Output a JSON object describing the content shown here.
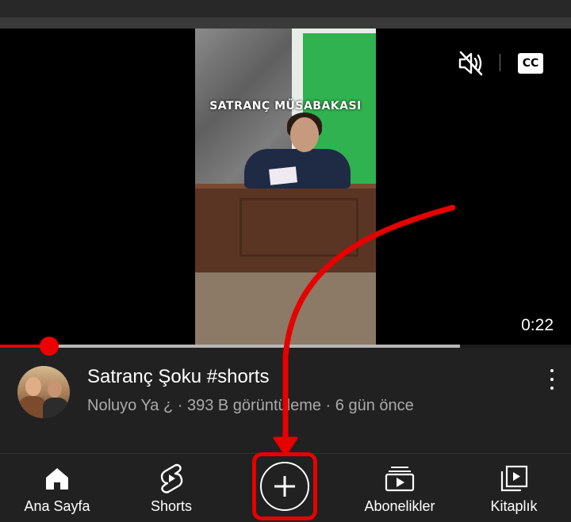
{
  "video": {
    "caption_overlay": "SATRANÇ MÜSABAKASI",
    "duration": "0:22",
    "progress": {
      "played_fraction": 0.086,
      "buffered_fraction": 0.806
    },
    "controls": {
      "mute_icon": "speaker-muted-icon",
      "captions_label": "CC"
    }
  },
  "metadata": {
    "title": "Satranç Şoku #shorts",
    "channel": "Noluyo Ya ¿",
    "views": "393 B görüntüleme",
    "age": "6 gün önce",
    "separator": " · "
  },
  "nav": {
    "items": [
      {
        "label": "Ana Sayfa",
        "icon": "home-icon"
      },
      {
        "label": "Shorts",
        "icon": "shorts-icon"
      },
      {
        "label": "",
        "icon": "create-plus-icon"
      },
      {
        "label": "Abonelikler",
        "icon": "subscriptions-icon"
      },
      {
        "label": "Kitaplık",
        "icon": "library-icon"
      }
    ]
  },
  "annotation": {
    "color": "#e60000",
    "shape": "curved-arrow",
    "target": "create-button"
  },
  "colors": {
    "background": "#212121",
    "accent": "#ff0000",
    "meta_text": "#aaaaaa"
  }
}
